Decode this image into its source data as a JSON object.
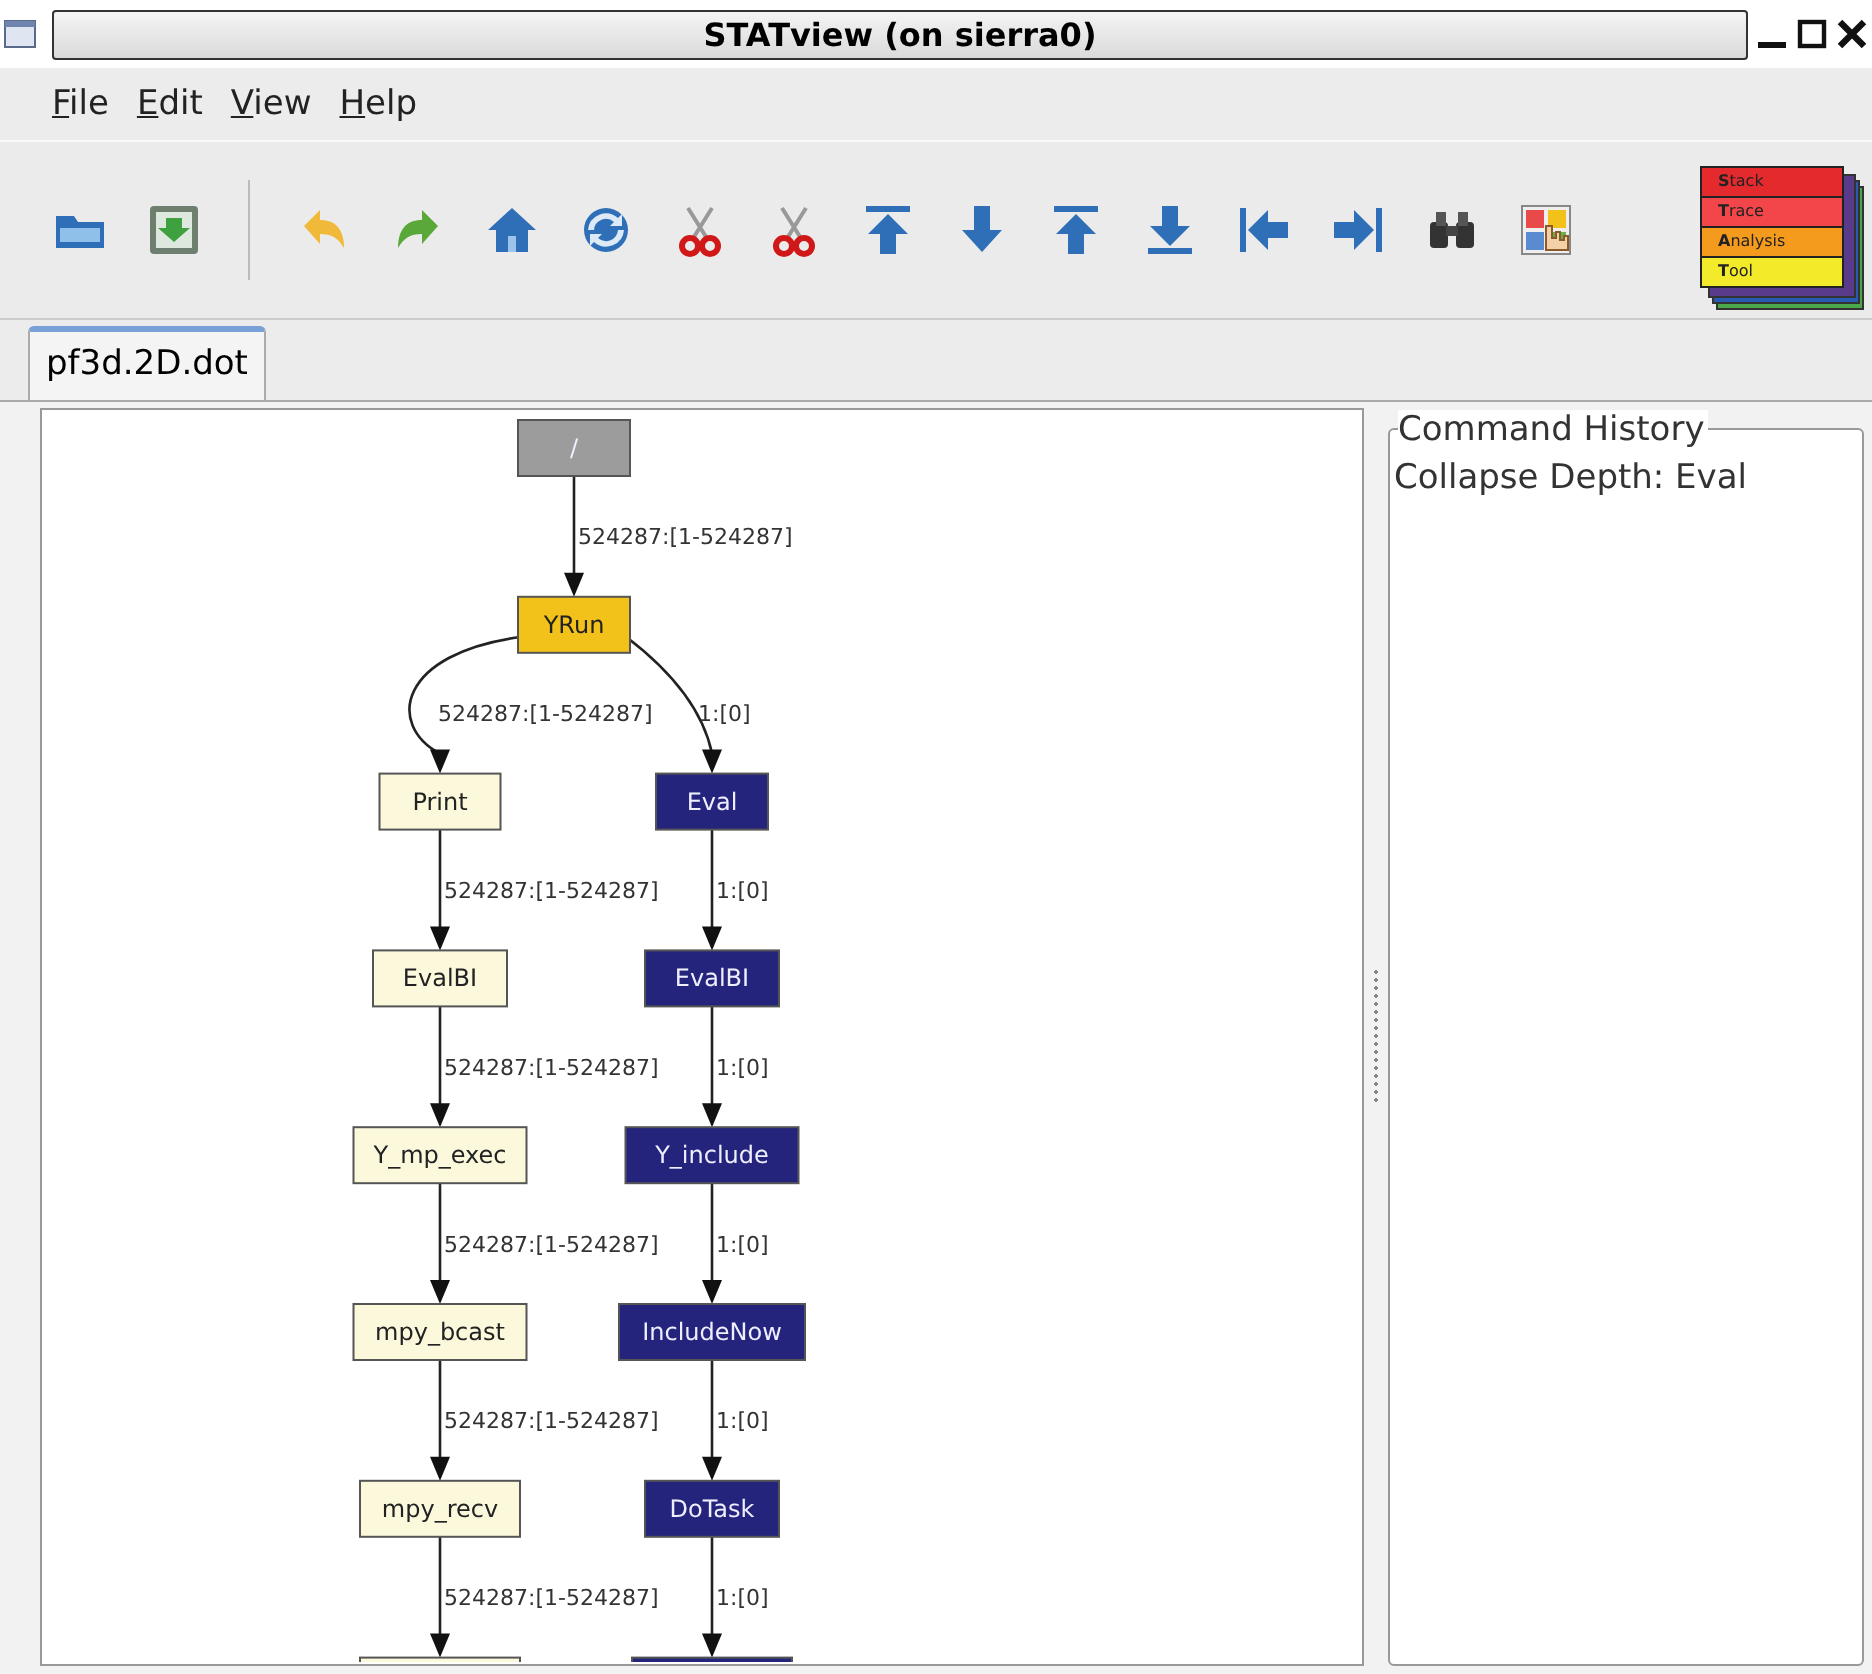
{
  "window": {
    "title": "STATview (on sierra0)"
  },
  "menu": [
    "File",
    "Edit",
    "View",
    "Help"
  ],
  "logo": {
    "layers": [
      {
        "text": "**S**tack",
        "color": "#e52a2e"
      },
      {
        "text": "**T**race",
        "color": "#f2464a"
      },
      {
        "text": "**A**nalysis",
        "color": "#f49a1c"
      },
      {
        "text": "**T**ool",
        "color": "#f3ea2a"
      }
    ]
  },
  "tabs": [
    {
      "label": "pf3d.2D.dot",
      "selected": true
    }
  ],
  "graph": {
    "root": {
      "label": "/",
      "color": "#9c9c9c",
      "children": [
        {
          "label": "YRun",
          "color": "#f2c21a",
          "edge_label": "524287:[1-524287]",
          "children": [
            {
              "label": "Print",
              "color": "#fbf8dc",
              "edge_label": "524287:[1-524287]",
              "children": [
                {
                  "label": "EvalBI",
                  "color": "#fbf8dc",
                  "edge_label": "524287:[1-524287]",
                  "children": [
                    {
                      "label": "Y_mp_exec",
                      "color": "#fbf8dc",
                      "edge_label": "524287:[1-524287]",
                      "children": [
                        {
                          "label": "mpy_bcast",
                          "color": "#fbf8dc",
                          "edge_label": "524287:[1-524287]",
                          "children": [
                            {
                              "label": "mpy_recv",
                              "color": "#fbf8dc",
                              "edge_label": "524287:[1-524287]",
                              "children": [
                                {
                                  "color": "#fbf8dc",
                                  "edge_label": "524287:[1-524287]"
                                }
                              ]
                            }
                          ]
                        }
                      ]
                    }
                  ]
                }
              ]
            },
            {
              "label": "Eval",
              "color": "#24247c",
              "edge_label": "1:[0]",
              "children": [
                {
                  "label": "EvalBI",
                  "color": "#24247c",
                  "edge_label": "1:[0]",
                  "children": [
                    {
                      "label": "Y_include",
                      "color": "#24247c",
                      "edge_label": "1:[0]",
                      "children": [
                        {
                          "label": "IncludeNow",
                          "color": "#24247c",
                          "edge_label": "1:[0]",
                          "children": [
                            {
                              "label": "DoTask",
                              "color": "#24247c",
                              "edge_label": "1:[0]",
                              "children": [
                                {
                                  "color": "#24247c",
                                  "edge_label": "1:[0]"
                                }
                              ]
                            }
                          ]
                        }
                      ]
                    }
                  ]
                }
              ]
            }
          ]
        }
      ]
    }
  },
  "command_history": {
    "title": "Command History",
    "entries": [
      "Collapse Depth: Eval"
    ]
  }
}
